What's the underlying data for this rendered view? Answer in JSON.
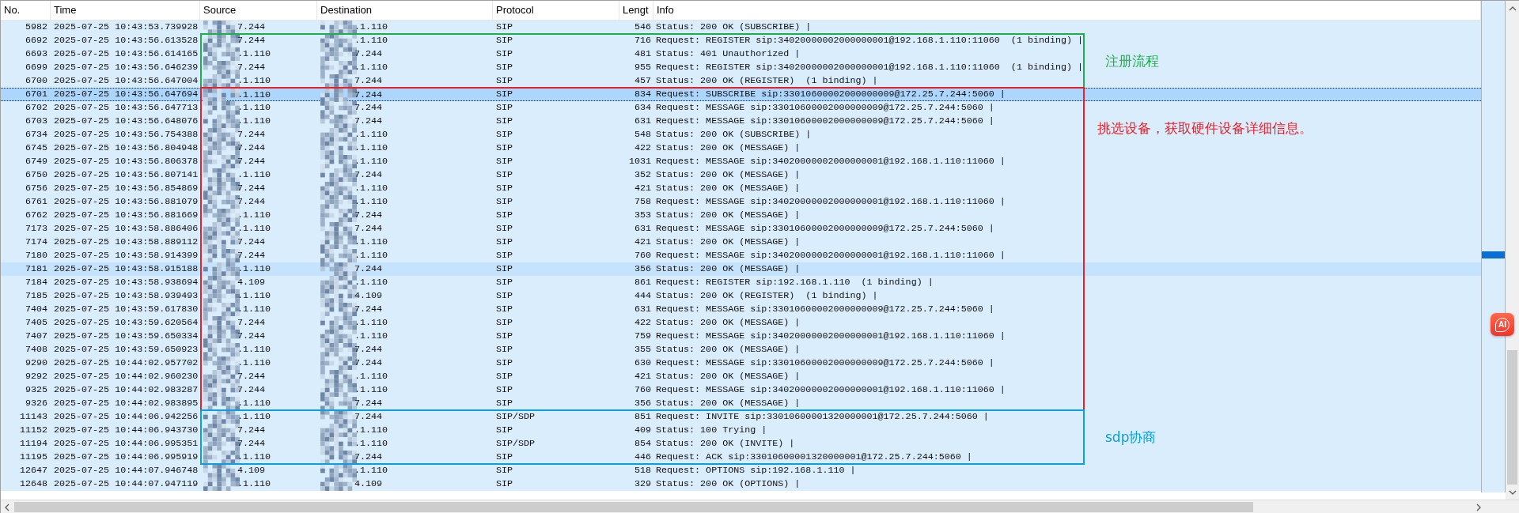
{
  "table": {
    "columns": [
      "No.",
      "Time",
      "Source",
      "Destination",
      "Protocol",
      "Lengt",
      "Info"
    ],
    "row_groups": [
      {
        "rows": [
          {
            "no": "5982",
            "time": "2025-07-25 10:43:53.739928",
            "source": "7.244",
            "destination": ".1.110",
            "protocol": "SIP",
            "length": "546",
            "info": "Status: 200 OK (SUBSCRIBE) |",
            "selected": false,
            "highlighted": false
          }
        ]
      },
      {
        "annotation": {
          "label": "注册流程",
          "color": "#1fae4c"
        },
        "rows": [
          {
            "no": "6692",
            "time": "2025-07-25 10:43:56.613528",
            "source": "7.244",
            "destination": ".1.110",
            "protocol": "SIP",
            "length": "716",
            "info": "Request: REGISTER sip:34020000002000000001@192.168.1.110:11060  (1 binding) |",
            "selected": false,
            "highlighted": false
          },
          {
            "no": "6693",
            "time": "2025-07-25 10:43:56.614165",
            "source": ".1.110",
            "destination": "7.244",
            "protocol": "SIP",
            "length": "481",
            "info": "Status: 401 Unauthorized |",
            "selected": false,
            "highlighted": false
          },
          {
            "no": "6699",
            "time": "2025-07-25 10:43:56.646239",
            "source": "7.244",
            "destination": ".1.110",
            "protocol": "SIP",
            "length": "955",
            "info": "Request: REGISTER sip:34020000002000000001@192.168.1.110:11060  (1 binding) |",
            "selected": false,
            "highlighted": false
          },
          {
            "no": "6700",
            "time": "2025-07-25 10:43:56.647004",
            "source": ".1.110",
            "destination": "7.244",
            "protocol": "SIP",
            "length": "457",
            "info": "Status: 200 OK (REGISTER)  (1 binding) |",
            "selected": false,
            "highlighted": false
          }
        ]
      },
      {
        "annotation": {
          "label": "挑选设备，获取硬件设备详细信息。",
          "color": "#e8202a"
        },
        "rows": [
          {
            "no": "6701",
            "time": "2025-07-25 10:43:56.647694",
            "source": ".1.110",
            "destination": "7.244",
            "protocol": "SIP",
            "length": "834",
            "info": "Request: SUBSCRIBE sip:33010600002000000009@172.25.7.244:5060 |",
            "selected": true,
            "highlighted": false
          },
          {
            "no": "6702",
            "time": "2025-07-25 10:43:56.647713",
            "source": ".1.110",
            "destination": "7.244",
            "protocol": "SIP",
            "length": "634",
            "info": "Request: MESSAGE sip:33010600002000000009@172.25.7.244:5060 |",
            "selected": false,
            "highlighted": false
          },
          {
            "no": "6703",
            "time": "2025-07-25 10:43:56.648076",
            "source": ".1.110",
            "destination": "7.244",
            "protocol": "SIP",
            "length": "631",
            "info": "Request: MESSAGE sip:33010600002000000009@172.25.7.244:5060 |",
            "selected": false,
            "highlighted": false
          },
          {
            "no": "6734",
            "time": "2025-07-25 10:43:56.754388",
            "source": "7.244",
            "destination": ".1.110",
            "protocol": "SIP",
            "length": "548",
            "info": "Status: 200 OK (SUBSCRIBE) |",
            "selected": false,
            "highlighted": false
          },
          {
            "no": "6745",
            "time": "2025-07-25 10:43:56.804948",
            "source": "7.244",
            "destination": ".1.110",
            "protocol": "SIP",
            "length": "422",
            "info": "Status: 200 OK (MESSAGE) |",
            "selected": false,
            "highlighted": false
          },
          {
            "no": "6749",
            "time": "2025-07-25 10:43:56.806378",
            "source": "7.244",
            "destination": ".1.110",
            "protocol": "SIP",
            "length": "1031",
            "info": "Request: MESSAGE sip:34020000002000000001@192.168.1.110:11060 |",
            "selected": false,
            "highlighted": false
          },
          {
            "no": "6750",
            "time": "2025-07-25 10:43:56.807141",
            "source": ".1.110",
            "destination": "7.244",
            "protocol": "SIP",
            "length": "352",
            "info": "Status: 200 OK (MESSAGE) |",
            "selected": false,
            "highlighted": false
          },
          {
            "no": "6756",
            "time": "2025-07-25 10:43:56.854869",
            "source": "7.244",
            "destination": ".1.110",
            "protocol": "SIP",
            "length": "421",
            "info": "Status: 200 OK (MESSAGE) |",
            "selected": false,
            "highlighted": false
          },
          {
            "no": "6761",
            "time": "2025-07-25 10:43:56.881079",
            "source": "7.244",
            "destination": ".1.110",
            "protocol": "SIP",
            "length": "758",
            "info": "Request: MESSAGE sip:34020000002000000001@192.168.1.110:11060 |",
            "selected": false,
            "highlighted": false
          },
          {
            "no": "6762",
            "time": "2025-07-25 10:43:56.881669",
            "source": ".1.110",
            "destination": "7.244",
            "protocol": "SIP",
            "length": "353",
            "info": "Status: 200 OK (MESSAGE) |",
            "selected": false,
            "highlighted": false
          },
          {
            "no": "7173",
            "time": "2025-07-25 10:43:58.886406",
            "source": ".1.110",
            "destination": "7.244",
            "protocol": "SIP",
            "length": "631",
            "info": "Request: MESSAGE sip:33010600002000000009@172.25.7.244:5060 |",
            "selected": false,
            "highlighted": false
          },
          {
            "no": "7174",
            "time": "2025-07-25 10:43:58.889112",
            "source": "7.244",
            "destination": ".1.110",
            "protocol": "SIP",
            "length": "421",
            "info": "Status: 200 OK (MESSAGE) |",
            "selected": false,
            "highlighted": false
          },
          {
            "no": "7180",
            "time": "2025-07-25 10:43:58.914399",
            "source": "7.244",
            "destination": ".1.110",
            "protocol": "SIP",
            "length": "760",
            "info": "Request: MESSAGE sip:34020000002000000001@192.168.1.110:11060 |",
            "selected": false,
            "highlighted": false
          },
          {
            "no": "7181",
            "time": "2025-07-25 10:43:58.915188",
            "source": ".1.110",
            "destination": "7.244",
            "protocol": "SIP",
            "length": "356",
            "info": "Status: 200 OK (MESSAGE) |",
            "selected": false,
            "highlighted": true
          },
          {
            "no": "7184",
            "time": "2025-07-25 10:43:58.938694",
            "source": "4.109",
            "destination": ".1.110",
            "protocol": "SIP",
            "length": "861",
            "info": "Request: REGISTER sip:192.168.1.110  (1 binding) |",
            "selected": false,
            "highlighted": false
          },
          {
            "no": "7185",
            "time": "2025-07-25 10:43:58.939493",
            "source": ".1.110",
            "destination": "4.109",
            "protocol": "SIP",
            "length": "444",
            "info": "Status: 200 OK (REGISTER)  (1 binding) |",
            "selected": false,
            "highlighted": false
          },
          {
            "no": "7404",
            "time": "2025-07-25 10:43:59.617830",
            "source": ".1.110",
            "destination": "7.244",
            "protocol": "SIP",
            "length": "631",
            "info": "Request: MESSAGE sip:33010600002000000009@172.25.7.244:5060 |",
            "selected": false,
            "highlighted": false
          },
          {
            "no": "7405",
            "time": "2025-07-25 10:43:59.620564",
            "source": "7.244",
            "destination": ".1.110",
            "protocol": "SIP",
            "length": "422",
            "info": "Status: 200 OK (MESSAGE) |",
            "selected": false,
            "highlighted": false
          },
          {
            "no": "7407",
            "time": "2025-07-25 10:43:59.650334",
            "source": "7.244",
            "destination": ".1.110",
            "protocol": "SIP",
            "length": "759",
            "info": "Request: MESSAGE sip:34020000002000000001@192.168.1.110:11060 |",
            "selected": false,
            "highlighted": false
          },
          {
            "no": "7408",
            "time": "2025-07-25 10:43:59.650923",
            "source": ".1.110",
            "destination": "7.244",
            "protocol": "SIP",
            "length": "355",
            "info": "Status: 200 OK (MESSAGE) |",
            "selected": false,
            "highlighted": false
          },
          {
            "no": "9290",
            "time": "2025-07-25 10:44:02.957702",
            "source": ".1.110",
            "destination": "7.244",
            "protocol": "SIP",
            "length": "630",
            "info": "Request: MESSAGE sip:33010600002000000009@172.25.7.244:5060 |",
            "selected": false,
            "highlighted": false
          },
          {
            "no": "9292",
            "time": "2025-07-25 10:44:02.960230",
            "source": "7.244",
            "destination": ".1.110",
            "protocol": "SIP",
            "length": "421",
            "info": "Status: 200 OK (MESSAGE) |",
            "selected": false,
            "highlighted": false
          },
          {
            "no": "9325",
            "time": "2025-07-25 10:44:02.983287",
            "source": "7.244",
            "destination": ".1.110",
            "protocol": "SIP",
            "length": "760",
            "info": "Request: MESSAGE sip:34020000002000000001@192.168.1.110:11060 |",
            "selected": false,
            "highlighted": false
          },
          {
            "no": "9326",
            "time": "2025-07-25 10:44:02.983895",
            "source": ".1.110",
            "destination": "7.244",
            "protocol": "SIP",
            "length": "356",
            "info": "Status: 200 OK (MESSAGE) |",
            "selected": false,
            "highlighted": false
          }
        ]
      },
      {
        "annotation": {
          "label": "sdp协商",
          "color": "#0a9fdf"
        },
        "rows": [
          {
            "no": "11143",
            "time": "2025-07-25 10:44:06.942256",
            "source": ".1.110",
            "destination": "7.244",
            "protocol": "SIP/SDP",
            "length": "851",
            "info": "Request: INVITE sip:33010600001320000001@172.25.7.244:5060 |",
            "selected": false,
            "highlighted": false
          },
          {
            "no": "11152",
            "time": "2025-07-25 10:44:06.943730",
            "source": "7.244",
            "destination": ".1.110",
            "protocol": "SIP",
            "length": "409",
            "info": "Status: 100 Trying |",
            "selected": false,
            "highlighted": false
          },
          {
            "no": "11194",
            "time": "2025-07-25 10:44:06.995351",
            "source": "7.244",
            "destination": ".1.110",
            "protocol": "SIP/SDP",
            "length": "854",
            "info": "Status: 200 OK (INVITE) |",
            "selected": false,
            "highlighted": false
          },
          {
            "no": "11195",
            "time": "2025-07-25 10:44:06.995919",
            "source": ".1.110",
            "destination": "7.244",
            "protocol": "SIP",
            "length": "446",
            "info": "Request: ACK sip:33010600001320000001@172.25.7.244:5060 |",
            "selected": false,
            "highlighted": false
          }
        ]
      },
      {
        "rows": [
          {
            "no": "12647",
            "time": "2025-07-25 10:44:07.946748",
            "source": "4.109",
            "destination": ".1.110",
            "protocol": "SIP",
            "length": "518",
            "info": "Request: OPTIONS sip:192.168.1.110 |",
            "selected": false,
            "highlighted": false
          },
          {
            "no": "12648",
            "time": "2025-07-25 10:44:07.947119",
            "source": ".1.110",
            "destination": "4.109",
            "protocol": "SIP",
            "length": "329",
            "info": "Status: 200 OK (OPTIONS) |",
            "selected": false,
            "highlighted": false
          }
        ]
      }
    ]
  },
  "assistant_button": {
    "label": "AI"
  }
}
